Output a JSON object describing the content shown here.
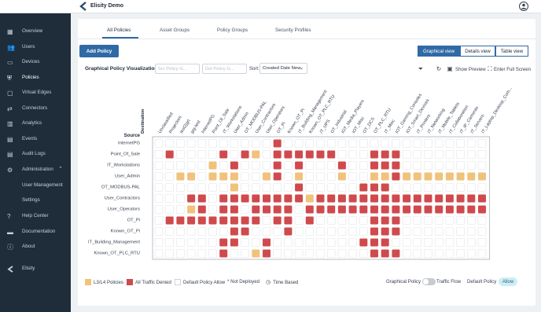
{
  "app": {
    "title": "Elisity Demo"
  },
  "sidebar": {
    "items": [
      {
        "label": "Overview",
        "icon": "dashboard-icon"
      },
      {
        "label": "Users",
        "icon": "users-icon"
      },
      {
        "label": "Devices",
        "icon": "devices-icon"
      },
      {
        "label": "Policies",
        "icon": "shield-icon",
        "active": true
      },
      {
        "label": "Virtual Edges",
        "icon": "monitor-icon"
      },
      {
        "label": "Connectors",
        "icon": "connectors-icon"
      },
      {
        "label": "Analytics",
        "icon": "analytics-icon"
      },
      {
        "label": "Events",
        "icon": "calendar-icon"
      },
      {
        "label": "Audit Logs",
        "icon": "audit-icon"
      },
      {
        "label": "Administration",
        "icon": "gear-icon"
      },
      {
        "label": "User Management"
      },
      {
        "label": "Settings"
      },
      {
        "label": "Help Center",
        "icon": "help-icon"
      },
      {
        "label": "Documentation",
        "icon": "book-icon"
      },
      {
        "label": "About",
        "icon": "info-icon"
      }
    ],
    "bottom": {
      "label": "Elisity",
      "icon": "elisity-logo-icon"
    }
  },
  "tabs": [
    "All Policies",
    "Asset Groups",
    "Policy Groups",
    "Security Profiles"
  ],
  "toolbar": {
    "add_policy": "Add Policy",
    "views": [
      "Graphical view",
      "Details view",
      "Table view"
    ],
    "viz_title": "Graphical Policy Visualization",
    "filter1_placeholder": "Src Policy G...",
    "filter2_placeholder": "Dst Policy G...",
    "sort_label": "Sort:",
    "sort_value": "Created Date New",
    "show_preview": "Show Preview",
    "full_screen": "Enter Full Screen"
  },
  "matrix": {
    "axis_destination": "Destination",
    "axis_source": "Source",
    "columns": [
      "Unclassified",
      "Projectors",
      "test2jgrt",
      "jpg-test",
      "InternetPG",
      "Point_Of_Sale",
      "IT_Workstations",
      "User_Admin",
      "OT_MODBUS-PAL",
      "User_Contractors",
      "User_Operators",
      "OT_Pi",
      "Known_OT_Pi",
      "IT_Building_Management",
      "Known_OT_PLC_RTU",
      "IT_UPS",
      "OT_Industrial",
      "IOT_Media_Players",
      "IOT_Misc",
      "OT_DCS",
      "OT_PLC_RTU",
      "IT_Misc",
      "IOT_Gaming_Consoles",
      "IOT_Smart_Devices",
      "IT_Printers",
      "IT_Networking",
      "IT_Mobile_Tablets",
      "IT_Collaboration",
      "IT_IP_Cameras",
      "IT_Servers",
      "IT_Laptop_Desktop_Com..."
    ],
    "rows": [
      "InternetPG",
      "Point_Of_Sale",
      "IT_Workstations",
      "User_Admin",
      "OT_MODBUS-PAL",
      "User_Contractors",
      "User_Operators",
      "OT_Pi",
      "Known_OT_Pi",
      "IT_Building_Management",
      "Known_OT_PLC_RTU"
    ],
    "cells": [
      "...........R...................",
      ".R....R.RY.RRRRRR...RRR.........",
      ".....Y.R...R.R...R..RRR.........",
      "..YY.YYY..YR.Y...Y..YYRYYYYYYYY",
      ".......Y.....R.....RRR..........",
      "...RR.RRRRRRRRYRRRRRRRRRRRRRRRRR",
      "...YR.RR.RRRR.RRRRRRRRRRRRRRRRRR",
      ".RRRRRRRRR.RR.R.....RRR.........",
      ".......RR...R.......RRR.........",
      "......RR..R........RRR..........",
      "......R..YR.........RRR........."
    ],
    "colors": {
      "l3l4": "#f0c27b",
      "denied": "#cf4a4d",
      "allow": "#ffffff",
      "border": "#dfe3e7"
    }
  },
  "legend": {
    "l3l4": "L3/L4 Policies",
    "denied": "All Traffic Denied",
    "default_allow": "Default Policy Allow",
    "not_deployed": "* Not Deployed",
    "time_based": "Time Based",
    "graphical_policy": "Graphical Policy",
    "traffic_flow": "Traffic Flow",
    "default_policy": "Default Policy",
    "allow_badge": "Allow"
  }
}
